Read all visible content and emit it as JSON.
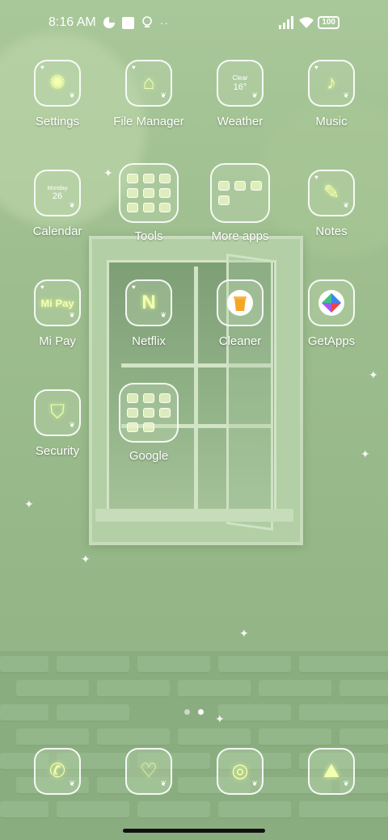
{
  "status_bar": {
    "time": "8:16 AM",
    "battery": "100",
    "icons": [
      "data-saver-icon",
      "square-icon",
      "bulb-icon",
      "more-dots-icon",
      "signal-icon",
      "wifi-icon",
      "battery-icon"
    ]
  },
  "apps": {
    "row1": [
      {
        "label": "Settings",
        "icon": "settings-icon"
      },
      {
        "label": "File Manager",
        "icon": "file-manager-icon"
      },
      {
        "label": "Weather",
        "icon": "weather-icon",
        "wx_condition": "Clear",
        "wx_temp": "16°"
      },
      {
        "label": "Music",
        "icon": "music-icon"
      }
    ],
    "row2": [
      {
        "label": "Calendar",
        "icon": "calendar-icon",
        "cal_day": "Monday",
        "cal_date": "26"
      },
      {
        "label": "Tools",
        "icon": "folder-icon"
      },
      {
        "label": "More apps",
        "icon": "folder-icon"
      },
      {
        "label": "Notes",
        "icon": "notes-icon"
      }
    ],
    "row3": [
      {
        "label": "Mi Pay",
        "icon": "mi-pay-icon",
        "badge": "Mi Pay"
      },
      {
        "label": "Netflix",
        "icon": "netflix-icon",
        "badge": "N"
      },
      {
        "label": "Cleaner",
        "icon": "cleaner-icon"
      },
      {
        "label": "GetApps",
        "icon": "getapps-icon"
      }
    ],
    "row4": [
      {
        "label": "Security",
        "icon": "security-icon"
      },
      {
        "label": "Google",
        "icon": "folder-icon"
      }
    ]
  },
  "dock": [
    {
      "icon": "phone-icon"
    },
    {
      "icon": "messages-icon"
    },
    {
      "icon": "chrome-icon"
    },
    {
      "icon": "gallery-icon"
    }
  ],
  "pages": {
    "count": 2,
    "active": 2
  },
  "colors": {
    "glow": "#e6ff8a",
    "wallpaper": "#a9c89a"
  }
}
